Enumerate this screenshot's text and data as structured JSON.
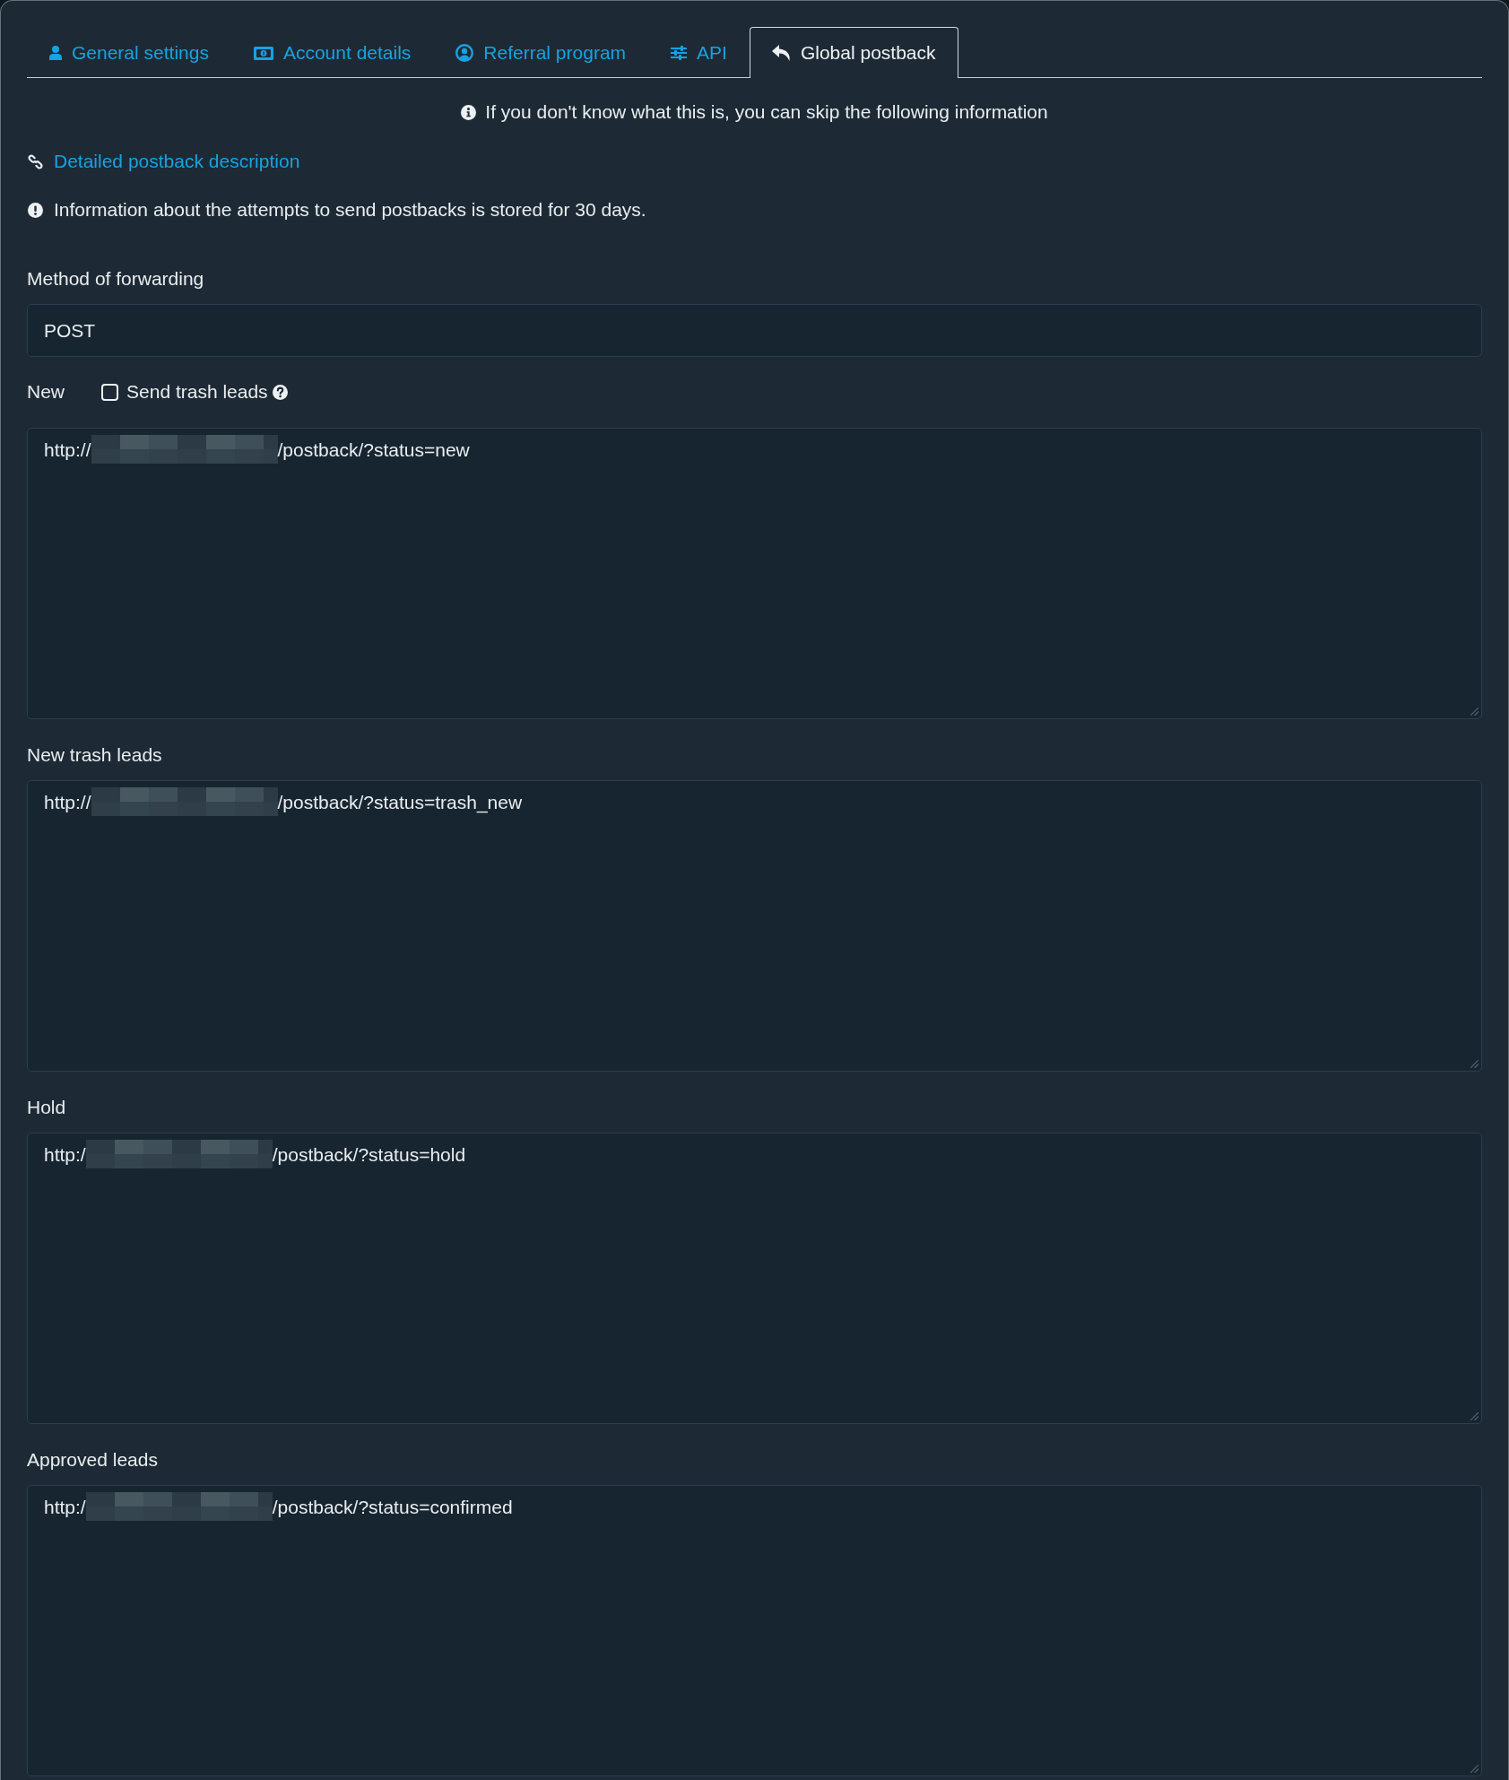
{
  "tabs": [
    {
      "label": "General settings",
      "selected": false
    },
    {
      "label": "Account details",
      "selected": false
    },
    {
      "label": "Referral program",
      "selected": false
    },
    {
      "label": "API",
      "selected": false
    },
    {
      "label": "Global postback",
      "selected": true
    }
  ],
  "notice": "If you don't know what this is, you can skip the following information",
  "doc_link": "Detailed postback description",
  "retention_note": "Information about the attempts to send postbacks is stored for 30 days.",
  "method": {
    "label": "Method of forwarding",
    "value": "POST"
  },
  "postbacks": [
    {
      "label": "New",
      "option": {
        "label": "Send trash leads",
        "checked": false
      },
      "value_start": "http://",
      "redacted": true,
      "value_end": "/postback/?status=new"
    },
    {
      "label": "New trash leads",
      "value_start": "http://",
      "redacted": true,
      "value_end": "/postback/?status=trash_new"
    },
    {
      "label": "Hold",
      "value_start": "http:/",
      "redacted": true,
      "value_end": "/postback/?status=hold"
    },
    {
      "label": "Approved leads",
      "value_start": "http:/",
      "redacted": true,
      "value_end": "/postback/?status=confirmed"
    }
  ]
}
